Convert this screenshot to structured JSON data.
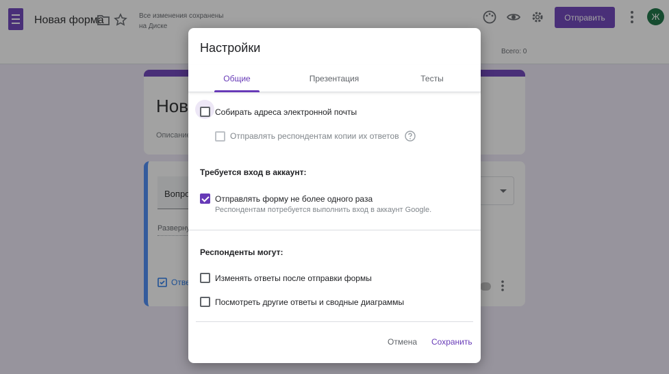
{
  "header": {
    "form_title": "Новая форма",
    "save_status_line1": "Все изменения сохранены",
    "save_status_line2": "на Диске",
    "send_label": "Отправить",
    "avatar_letter": "Ж",
    "total_count": "Всего: 0",
    "icons": [
      "forms-logo-icon",
      "folder-icon",
      "star-icon",
      "palette-icon",
      "eye-icon",
      "gear-icon",
      "more-vert-icon"
    ]
  },
  "background_form": {
    "title_fragment": "Нова",
    "description_fragment": "Описание",
    "question_fragment": "Вопро",
    "expand_fragment": "Разверну",
    "answers_fragment": "Отве"
  },
  "dialog": {
    "title": "Настройки",
    "tabs": [
      {
        "label": "Общие",
        "active": true
      },
      {
        "label": "Презентация",
        "active": false
      },
      {
        "label": "Тесты",
        "active": false
      }
    ],
    "collect_emails": {
      "label": "Собирать адреса электронной почты",
      "checked": false
    },
    "send_copies": {
      "label": "Отправлять респондентам копии их ответов",
      "checked": false,
      "disabled": true
    },
    "signin_heading": "Требуется вход в аккаунт:",
    "limit_one": {
      "label": "Отправлять форму не более одного раза",
      "hint": "Респондентам потребуется выполнить вход в аккаунт Google.",
      "checked": true
    },
    "respondents_heading": "Респонденты могут:",
    "edit_after": {
      "label": "Изменять ответы после отправки формы",
      "checked": false
    },
    "see_summary": {
      "label": "Посмотреть другие ответы и сводные диаграммы",
      "checked": false
    },
    "cancel_label": "Отмена",
    "save_label": "Сохранить"
  },
  "colors": {
    "accent": "#673ab7",
    "overlay": "#212121"
  }
}
